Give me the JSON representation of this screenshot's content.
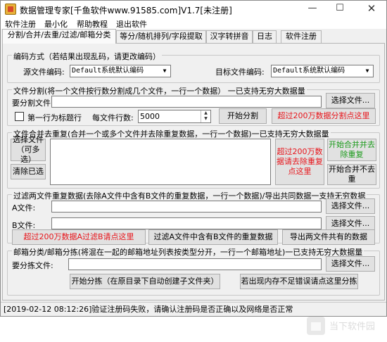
{
  "window": {
    "title": "数据管理专家[千鱼软件www.91585.com]V1.7[未注册]"
  },
  "menu": [
    "软件注册",
    "最小化",
    "帮助教程",
    "退出软件"
  ],
  "tabs": [
    "分割/合并/去重/过滤/邮箱分类",
    "等分/随机排列/字段提取",
    "汉字转拼音",
    "日志",
    "软件注册"
  ],
  "encoding": {
    "group_title": "编码方式（若结果出现乱码，请更改编码）",
    "source_label": "源文件编码:",
    "source_value": "Default系统默认编码",
    "target_label": "目标文件编码:",
    "target_value": "Default系统默认编码"
  },
  "split": {
    "group_title": "文件分割(将一个文件按行数分割成几个文件，一行一个数据） 一已支持无穷大数据量",
    "file_label": "要分割文件:",
    "select_btn": "选择文件...",
    "first_row_label": "第一行为标题行",
    "rows_label": "每文件行数:",
    "rows_value": "5000",
    "start_btn": "开始分割",
    "over_btn": "超过200万数据分割点这里"
  },
  "merge": {
    "group_title": "文件合并去重复(合并一个或多个文件并去除重复数据，一行一个数据)一已支持无穷大数据量",
    "select_btn": "选择文件（可多选）",
    "clear_btn": "清除已选",
    "over_btn": "超过200万数据请去除重复点这里",
    "merge_dedup_btn": "开始合并并去除重复",
    "merge_nodedup_btn": "开始合并不去重"
  },
  "filter": {
    "group_title": "过滤两文件重复数据(去除A文件中含有B文件的重复数据，一行一个数据)/导出共同数据一支持无穷数据",
    "a_label": "A文件:",
    "b_label": "B文件:",
    "select_a_btn": "选择文件...",
    "select_b_btn": "选择文件...",
    "over_btn": "超过200万数据A过滤B请点这里",
    "filter_btn": "过滤A文件中含有B文件的重复数据",
    "export_btn": "导出两文件共有的数据"
  },
  "email": {
    "group_title": "邮箱分类/邮箱分拣(将混在一起的邮箱地址列表按类型分开，一行一个邮箱地址)一已支持无穷大数据量",
    "file_label": "要分拣文件:",
    "select_btn": "选择文件...",
    "start_btn": "开始分拣（在原目录下自动创建子文件夹）",
    "error_btn": "若出现内存不足错误请点这里分拣"
  },
  "status": "[2019-02-12 08:12:26]验证注册码失败，请确认注册码是否正确以及网络是否正常",
  "watermark": "当下软件园"
}
